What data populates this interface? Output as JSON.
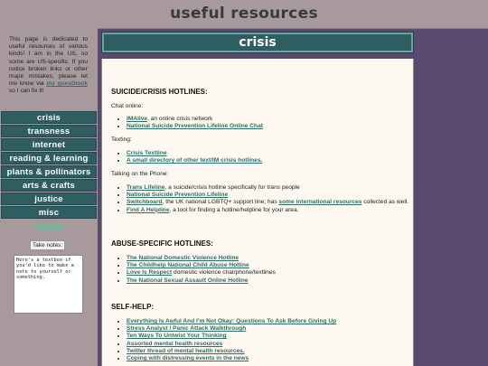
{
  "site": {
    "title": "useful resources"
  },
  "intro": {
    "text_before": "This page is dedicated to useful resources of various kinds! I am in the US, so some are US-specific. If you notice broken links or other major mistakes, please let me know via ",
    "link": "my guestbook",
    "text_after": " so I can fix it!"
  },
  "nav": {
    "items": [
      "crisis",
      "transness",
      "internet",
      "reading & learning",
      "plants & pollinators",
      "arts & crafts",
      "justice",
      "misc"
    ]
  },
  "notes": {
    "label": "Take notes:",
    "value": "Here's a textbox if you'd like to make a note to yourself or something."
  },
  "page": {
    "heading": "crisis"
  },
  "sections": {
    "hotlines": {
      "heading": "SUICIDE/CRISIS HOTLINES:",
      "chat_label": "Chat online:",
      "chat": [
        {
          "link": "IMAlive",
          "rest": ", an online crisis network"
        },
        {
          "link": "National Suicide Prevention Lifeline Online Chat",
          "rest": ""
        }
      ],
      "text_label": "Texting:",
      "text": [
        {
          "link": "Crisis Textline",
          "rest": ""
        },
        {
          "link": "A small directory of other text/IM crisis hotlines.",
          "rest": ""
        }
      ],
      "phone_label": "Talking on the Phone:",
      "phone": {
        "i0_link": "Trans Lifeline",
        "i0_rest": ", a suicide/crisis hotline specifically for trans people",
        "i1_link": "National Suicide Prevention Lifeline",
        "i2_link": "Switchboard",
        "i2_mid": ", the UK national LGBTQ+ support line; has ",
        "i2_link2": "some international resources",
        "i2_rest": " collected as well.",
        "i3_link": "Find A Helpline",
        "i3_rest": ", a tool for finding a hotline/helpline for your area."
      }
    },
    "abuse": {
      "heading": "ABUSE-SPECIFIC HOTLINES:",
      "items": [
        {
          "link": "The National Domestic Violence Hotline",
          "rest": ""
        },
        {
          "link": "The Childhelp National Child Abuse Hotline",
          "rest": ""
        },
        {
          "link": "Love Is Respect",
          "rest": " domestic violence chat/phone/textlines"
        },
        {
          "link": "The National Sexual Assault Online Hotline",
          "rest": ""
        }
      ]
    },
    "selfhelp": {
      "heading": "SELF-HELP:",
      "items": [
        "Everything Is Awful And I'm Not Okay: Questions To Ask Before Giving Up",
        "Stress Analyst / Panic Attack Walkthrough",
        "Ten Ways To Untwist Your Thinking",
        "Assorted mental health resources",
        "Twitter thread of mental health resources.",
        "Coping with distressing events in the news"
      ]
    }
  }
}
